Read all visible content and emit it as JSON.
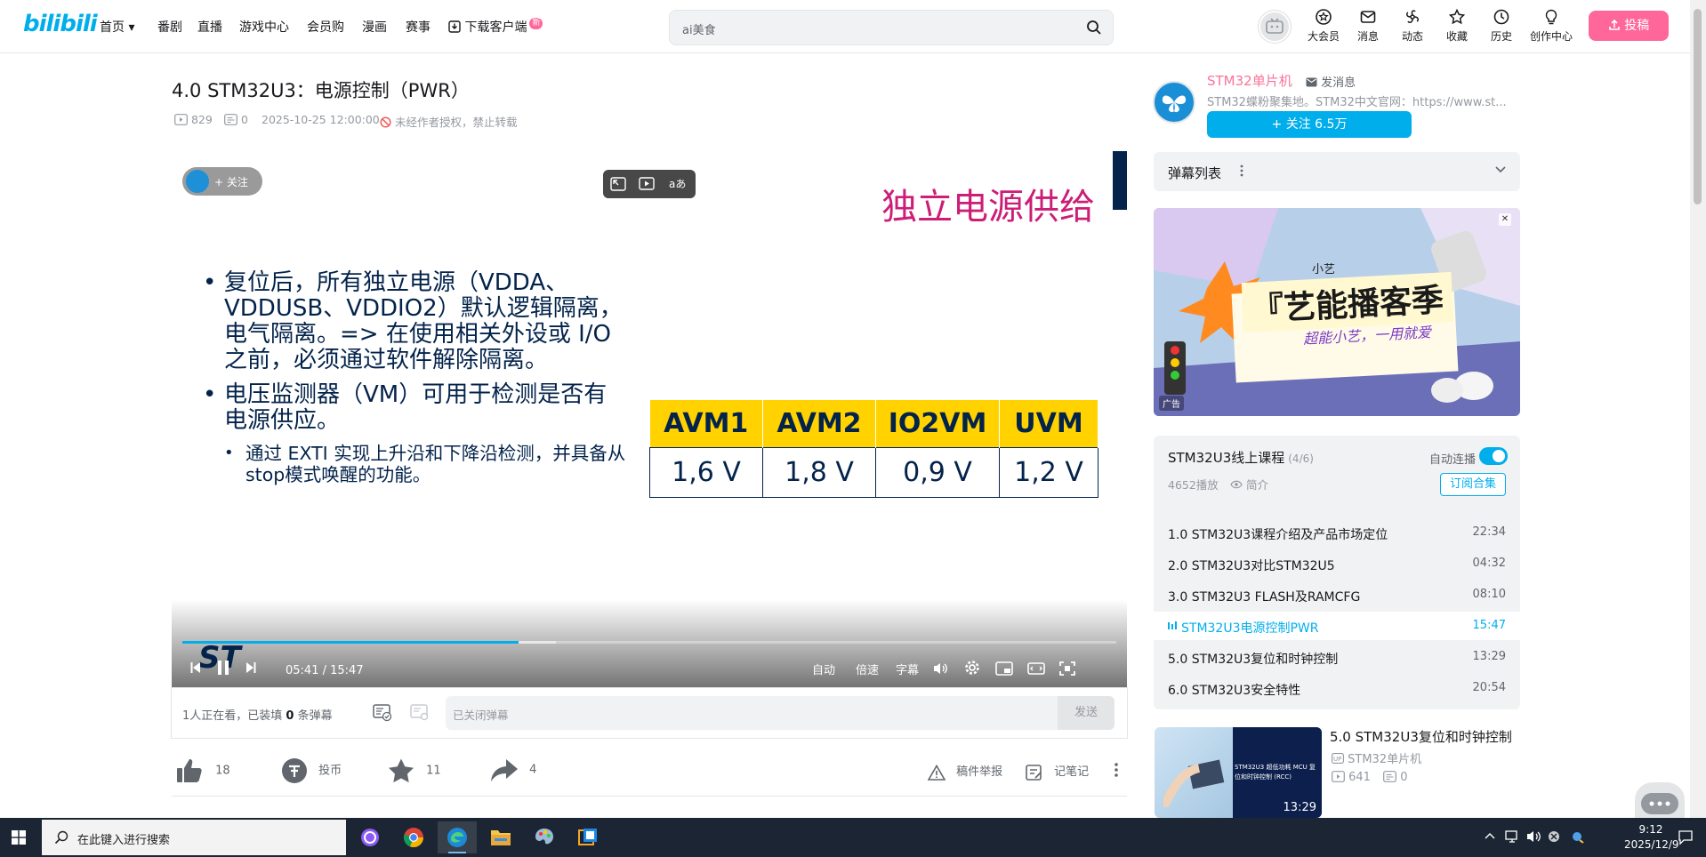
{
  "header": {
    "logo": "bilibili",
    "nav": [
      "首页",
      "番剧",
      "直播",
      "游戏中心",
      "会员购",
      "漫画",
      "赛事",
      "下载客户端"
    ],
    "new_badge": "新",
    "search_placeholder": "ai美食",
    "icons": [
      {
        "label": "大会员",
        "icon": "vip-icon"
      },
      {
        "label": "消息",
        "icon": "message-icon"
      },
      {
        "label": "动态",
        "icon": "dynamic-icon"
      },
      {
        "label": "收藏",
        "icon": "favorite-icon"
      },
      {
        "label": "历史",
        "icon": "history-icon"
      },
      {
        "label": "创作中心",
        "icon": "creator-icon"
      }
    ],
    "upload": "投稿"
  },
  "video": {
    "title": "4.0 STM32U3：电源控制（PWR）",
    "views": "829",
    "danmaku_count": "0",
    "date": "2025-10-25 12:00:00",
    "copyright": "未经作者授权，禁止转载",
    "follow_pill": "+ 关注",
    "slide": {
      "title": "独立电源供给",
      "bullet1": "复位后，所有独立电源（VDDA、VDDUSB、VDDIO2）默认逻辑隔离，电气隔离。=> 在使用相关外设或 I/O 之前，必须通过软件解除隔离。",
      "bullet2": "电压监测器（VM）可用于检测是否有电源供应。",
      "sub_bullet": "通过 EXTI 实现上升沿和下降沿检测，并具备从stop模式唤醒的功能。",
      "table_headers": [
        "AVM1",
        "AVM2",
        "IO2VM",
        "UVM"
      ],
      "table_values": [
        "1,6 V",
        "1,8 V",
        "0,9 V",
        "1,2 V"
      ],
      "logo": "ST"
    },
    "time_current": "05:41",
    "time_total": "15:47",
    "progress": 0.36,
    "buffered": 0.31,
    "controls": {
      "quality": "自动",
      "speed": "倍速",
      "subtitle": "字幕"
    }
  },
  "danmaku_bar": {
    "watching": "1人正在看，已装填",
    "count": "0",
    "suffix": "条弹幕",
    "input_placeholder": "已关闭弹幕",
    "send": "发送"
  },
  "actions": {
    "like": "18",
    "coin": "投币",
    "fav": "11",
    "share": "4",
    "report": "稿件举报",
    "note": "记笔记"
  },
  "uploader": {
    "name": "STM32单片机",
    "message": "发消息",
    "desc": "STM32蝶粉聚集地。STM32中文官网：https://www.st...",
    "follow": "+ 关注 6.5万"
  },
  "danmaku_list": "弹幕列表",
  "ad": {
    "brand": "小艺",
    "headline": "『艺能播客季",
    "slogan": "超能小艺，一用就爱",
    "badge": "广告"
  },
  "playlist": {
    "title": "STM32U3线上课程",
    "progress": "(4/6)",
    "autoplay": "自动连播",
    "plays": "4652播放",
    "intro": "简介",
    "subscribe": "订阅合集",
    "episodes": [
      {
        "title": "1.0 STM32U3课程介绍及产品市场定位",
        "duration": "22:34"
      },
      {
        "title": "2.0 STM32U3对比STM32U5",
        "duration": "04:32"
      },
      {
        "title": "3.0 STM32U3 FLASH及RAMCFG",
        "duration": "08:10"
      },
      {
        "title": "STM32U3电源控制PWR",
        "duration": "15:47"
      },
      {
        "title": "5.0 STM32U3复位和时钟控制",
        "duration": "13:29"
      },
      {
        "title": "6.0 STM32U3安全特性",
        "duration": "20:54"
      }
    ]
  },
  "recommend": {
    "title": "5.0 STM32U3复位和时钟控制",
    "up": "STM32单片机",
    "views": "641",
    "danmaku": "0",
    "duration": "13:29",
    "thumb_text": "STM32U3 超低功耗 MCU 复位和时钟控制 (RCC)"
  },
  "taskbar": {
    "search": "在此键入进行搜索",
    "time": "9:12",
    "date": "2025/12/9"
  },
  "colors": {
    "accent": "#00aeec",
    "pink": "#fb7299",
    "st_navy": "#03234b",
    "st_yellow": "#ffd200",
    "slide_magenta": "#cc1d77"
  }
}
